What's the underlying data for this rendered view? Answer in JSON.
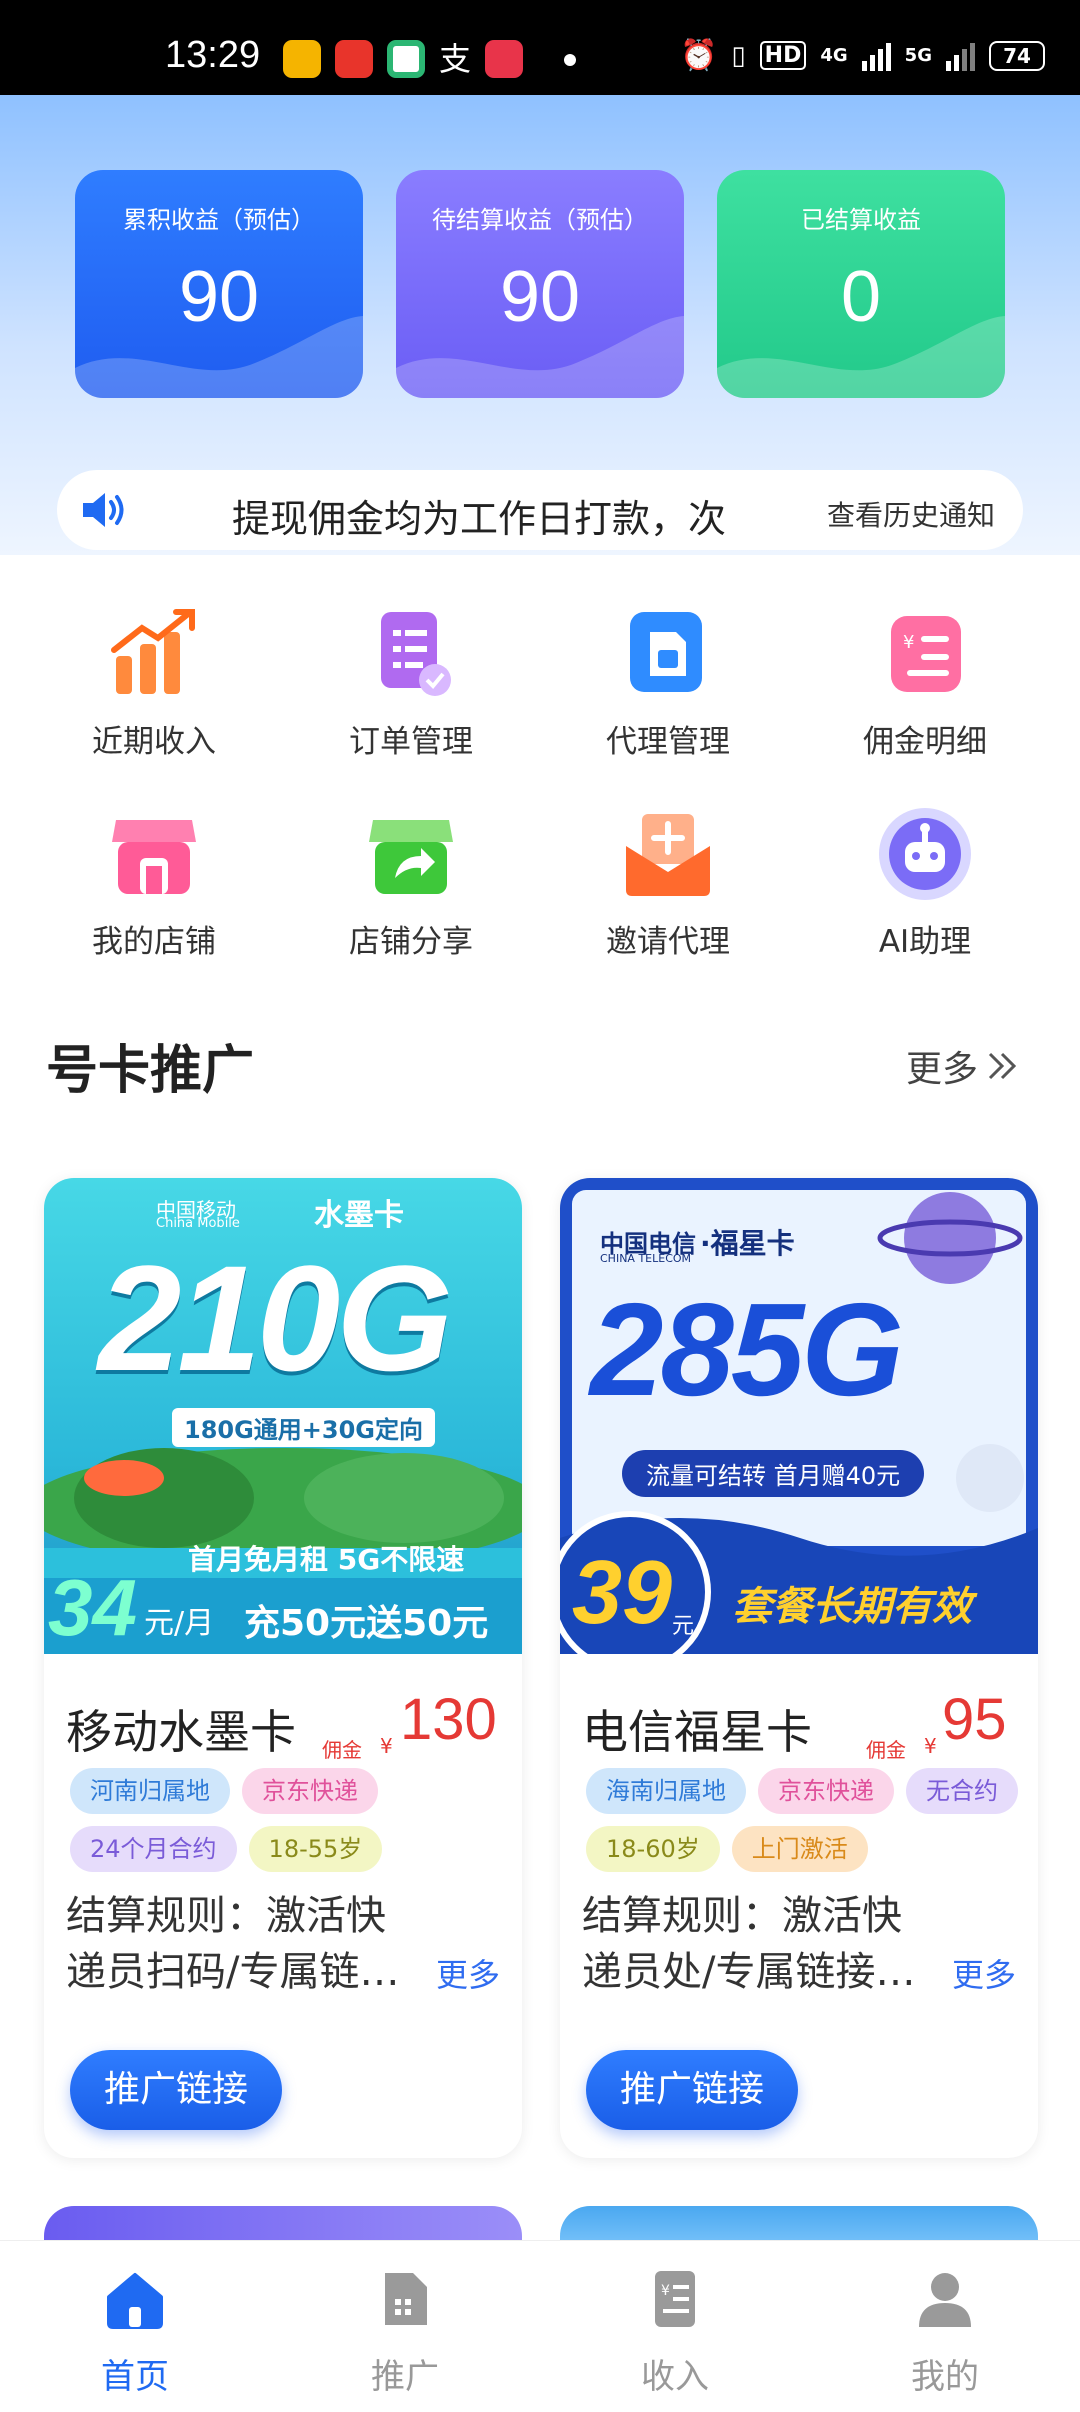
{
  "status_bar": {
    "time": "13:29",
    "network_1": "4G",
    "network_2": "5G",
    "hd": "HD",
    "battery": "74"
  },
  "stats": [
    {
      "label": "累积收益（预估）",
      "value": "90"
    },
    {
      "label": "待结算收益（预估）",
      "value": "90"
    },
    {
      "label": "已结算收益",
      "value": "0"
    }
  ],
  "notice": {
    "text": "提现佣金均为工作日打款，次",
    "history_link": "查看历史通知"
  },
  "grid": [
    {
      "label": "近期收入",
      "icon": "chart-up-icon"
    },
    {
      "label": "订单管理",
      "icon": "order-list-icon"
    },
    {
      "label": "代理管理",
      "icon": "sim-card-icon"
    },
    {
      "label": "佣金明细",
      "icon": "yen-doc-icon"
    },
    {
      "label": "我的店铺",
      "icon": "store-icon"
    },
    {
      "label": "店铺分享",
      "icon": "share-store-icon"
    },
    {
      "label": "邀请代理",
      "icon": "invite-envelope-icon"
    },
    {
      "label": "AI助理",
      "icon": "robot-icon"
    }
  ],
  "section": {
    "title": "号卡推广",
    "more": "更多"
  },
  "products": [
    {
      "banner": {
        "brand": "中国移动",
        "brand_en": "China Mobile",
        "card": "水墨卡",
        "big": "210G",
        "sub": "180G通用+30G定向",
        "ribbon": "首月免月租 5G不限速",
        "price": "34",
        "unit": "元/月",
        "promo": "充50元送50元"
      },
      "name": "移动水墨卡",
      "commission_label": "佣金",
      "currency": "¥",
      "price": "130",
      "tags": [
        "河南归属地",
        "京东快递",
        "24个月合约",
        "18-55岁"
      ],
      "rules_1": "结算规则：激活快",
      "rules_2": "递员扫码/专属链接激活",
      "more": "更多",
      "button": "推广链接"
    },
    {
      "banner": {
        "brand": "中国电信",
        "brand_en": "CHINA TELECOM",
        "card": "·福星卡",
        "big": "285G",
        "sub": "流量可结转 首月赠40元",
        "price": "39",
        "unit": "元",
        "promo": "套餐长期有效"
      },
      "name": "电信福星卡",
      "commission_label": "佣金",
      "currency": "¥",
      "price": "95",
      "tags": [
        "海南归属地",
        "京东快递",
        "无合约",
        "18-60岁",
        "上门激活"
      ],
      "rules_1": "结算规则：激活快",
      "rules_2": "递员处/专属链接激活",
      "more": "更多",
      "button": "推广链接"
    }
  ],
  "tabs": [
    {
      "label": "首页",
      "icon": "home-icon",
      "active": true
    },
    {
      "label": "推广",
      "icon": "promo-sim-icon",
      "active": false
    },
    {
      "label": "收入",
      "icon": "income-doc-icon",
      "active": false
    },
    {
      "label": "我的",
      "icon": "user-icon",
      "active": false
    }
  ],
  "colors": {
    "accent": "#1f6af2",
    "price": "#e53935"
  }
}
